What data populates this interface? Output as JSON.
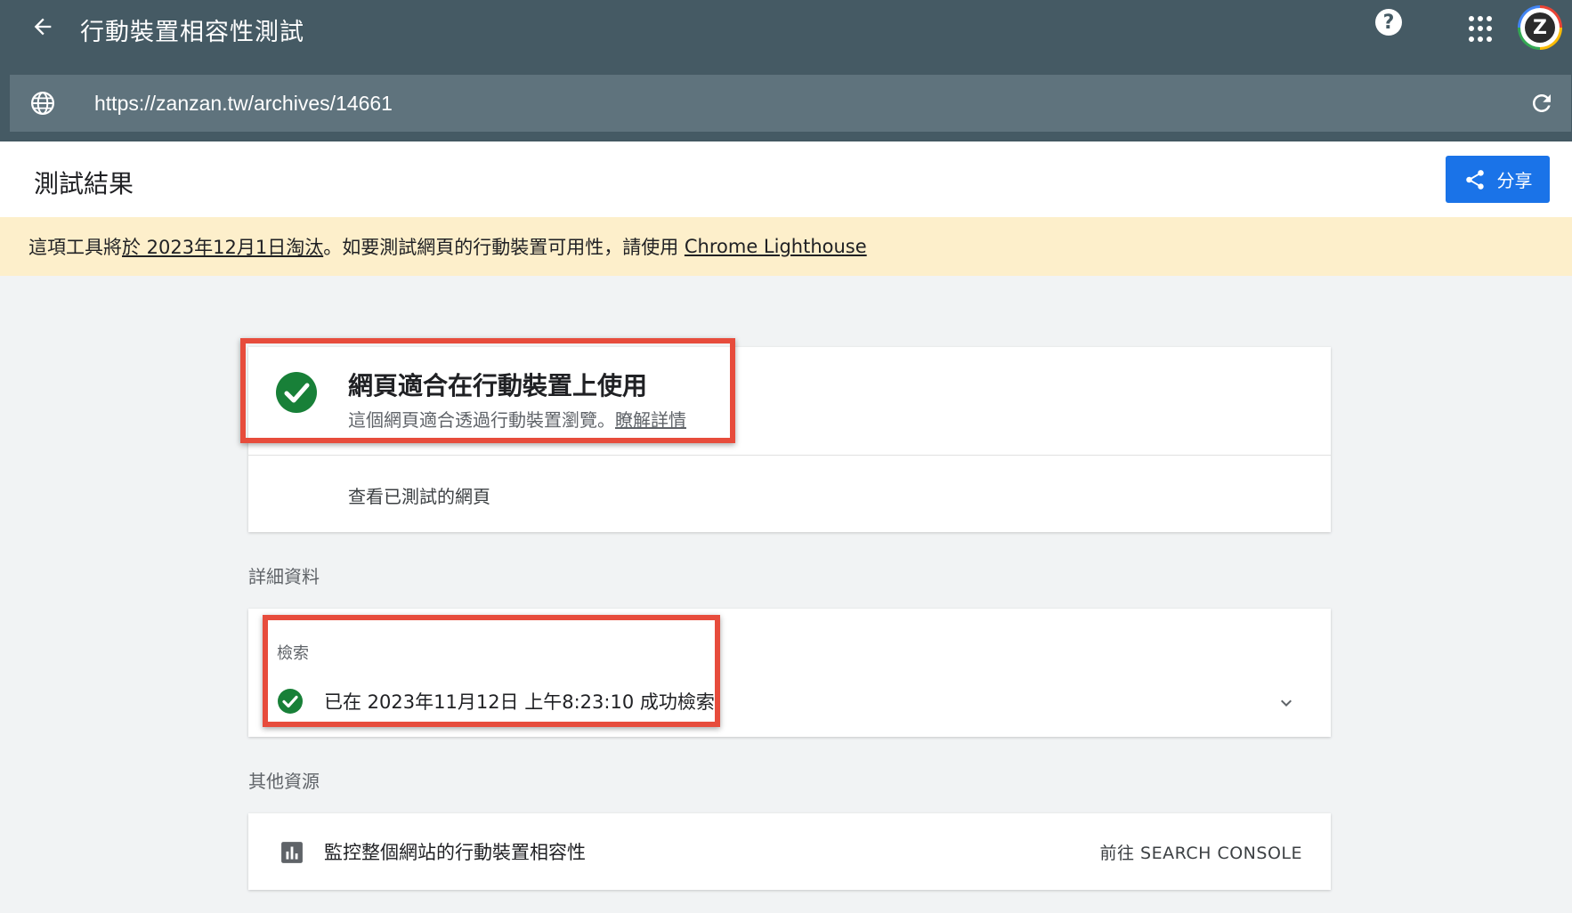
{
  "app": {
    "title": "行動裝置相容性測試"
  },
  "urlbar": {
    "url": "https://zanzan.tw/archives/14661"
  },
  "avatar": {
    "letter": "Z"
  },
  "results": {
    "title": "測試結果",
    "share_label": "分享"
  },
  "banner": {
    "text_before": "這項工具將",
    "date_link": "於 2023年12月1日淘汰",
    "text_middle": "。如要測試網頁的行動裝置可用性，請使用 ",
    "lighthouse_link": "Chrome Lighthouse"
  },
  "main_result": {
    "title": "網頁適合在行動裝置上使用",
    "subtitle": "這個網頁適合透過行動裝置瀏覽。",
    "learn_more": "瞭解詳情",
    "view_tested": "查看已測試的網頁"
  },
  "details": {
    "section_title": "詳細資料",
    "crawl_label": "檢索",
    "crawl_status": "已在 2023年11月12日 上午8:23:10 成功檢索"
  },
  "resources": {
    "section_title": "其他資源",
    "item_text": "監控整個網站的行動裝置相容性",
    "item_link": "前往 SEARCH CONSOLE"
  },
  "colors": {
    "topbar": "#455a64",
    "urlbar": "#5f737d",
    "accent_blue": "#1a73e8",
    "success_green": "#188038",
    "banner_bg": "#fdefcb",
    "highlight_red": "#e74c3c"
  },
  "icons": [
    "back-arrow-icon",
    "help-icon",
    "apps-grid-icon",
    "globe-icon",
    "refresh-icon",
    "share-icon",
    "check-circle-icon",
    "chevron-down-icon",
    "bar-chart-icon"
  ]
}
